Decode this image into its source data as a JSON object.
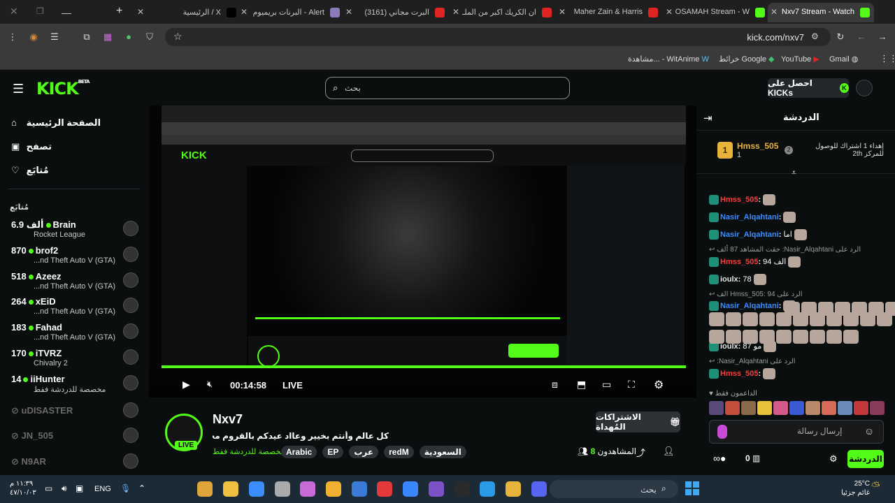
{
  "browser": {
    "tabs": [
      {
        "title": "Nxv7 Stream - Watch",
        "fav": "#53fc18"
      },
      {
        "title": "OSAMAH Stream - W",
        "fav": "#53fc18"
      },
      {
        "title": "Maher Zain & Harris",
        "fav": "#e02323"
      },
      {
        "title": "ان الكريك اكبر من الملـ",
        "fav": "#e02323"
      },
      {
        "title": "(3161) البرت مجاني",
        "fav": "#e02323"
      },
      {
        "title": "البرنات بريميوم - Alert",
        "fav": "#8a7ab8"
      },
      {
        "title": "الرئيسية / X",
        "fav": "#000000"
      }
    ],
    "url": "kick.com/nxv7",
    "bookmarks": [
      "Gmail",
      "YouTube",
      "خرائط Google",
      "مشاهدة... - WitAnime"
    ]
  },
  "kick": {
    "search_placeholder": "بحث",
    "get_kicks": "احصل على KICKs",
    "nav": [
      "الصفحة الرئيسية",
      "تصفح",
      "مُتابَع"
    ],
    "following_header": "مُتابَع",
    "following": [
      {
        "name": "Brain",
        "viewers": "6.9 ألف",
        "game": "Rocket League",
        "live": true
      },
      {
        "name": "brof2",
        "viewers": "870",
        "game": "...nd Theft Auto V (GTA)",
        "live": true
      },
      {
        "name": "Azeez",
        "viewers": "518",
        "game": "...nd Theft Auto V (GTA)",
        "live": true
      },
      {
        "name": "xEiD",
        "viewers": "264",
        "game": "...nd Theft Auto V (GTA)",
        "live": true
      },
      {
        "name": "Fahad",
        "viewers": "183",
        "game": "...nd Theft Auto V (GTA)",
        "live": true
      },
      {
        "name": "iTVRZ",
        "viewers": "170",
        "game": "Chivalry 2",
        "live": true
      },
      {
        "name": "iiHunter",
        "viewers": "14",
        "game": "مخصصة للدردشة فقط",
        "live": true
      },
      {
        "name": "uDISASTER",
        "viewers": "",
        "game": "",
        "live": false
      },
      {
        "name": "JN_505",
        "viewers": "",
        "game": "",
        "live": false
      },
      {
        "name": "N9AR",
        "viewers": "",
        "game": "",
        "live": false
      }
    ]
  },
  "player": {
    "time": "00:14:58",
    "live": "LIVE"
  },
  "stream": {
    "channel": "Nxv7",
    "title": "كل عالم وأنتم بخيير وعااد عيدكم بالقروم محمد | EP - !MT!",
    "category": "مخصصة للدردشة فقط",
    "tags": [
      "السعودية",
      "redM",
      "عرب",
      "EP",
      "Arabic"
    ],
    "viewers_label": "المشاهدون",
    "viewers": "8",
    "gift_subs": "الاشتراكات المُهداة",
    "live_badge": "LIVE"
  },
  "chat": {
    "title": "الدردشة",
    "top_user": "Hmss_505",
    "top_rank": "1",
    "top_count": "1",
    "goal_text": "إهداء 1 اشتراك للوصول للمركز 2th",
    "goal_rank": "2",
    "messages": [
      {
        "user": "Hmss_505",
        "color": "#ff3b3b",
        "text": ""
      },
      {
        "user": "Nasir_Alqahtani",
        "color": "#3a8cff",
        "text": ""
      },
      {
        "user": "Nasir_Alqahtani",
        "color": "#3a8cff",
        "text": "اما"
      },
      {
        "reply": "الرد على Nasir_Alqahtani: حقت المشاهد 87 ألف"
      },
      {
        "user": "Hmss_505",
        "color": "#ff3b3b",
        "text": "94 الف"
      },
      {
        "user": "ioulx",
        "color": "#e6e6e6",
        "text": "78"
      },
      {
        "reply": "الرد على Hmss_505: 94 الف"
      },
      {
        "user": "Nasir_Alqahtani",
        "color": "#3a8cff",
        "text": ""
      },
      {
        "user": "ioulx",
        "color": "#e6e6e6",
        "text": "87 مو"
      },
      {
        "reply": "الرد على Nasir_Alqahtani:"
      },
      {
        "user": "Hmss_505",
        "color": "#ff3b3b",
        "text": ""
      }
    ],
    "supporters_label": "الداعمون فقط",
    "input_placeholder": "إرسال رسالة",
    "send": "الدردشة",
    "points": "0"
  },
  "taskbar": {
    "time": "١١:٣٩ م",
    "date": "٤٧/١٠/٠٣",
    "lang": "ENG",
    "search": "بحث",
    "weather_temp": "25°C",
    "weather_desc": "غائم جزئيا"
  }
}
